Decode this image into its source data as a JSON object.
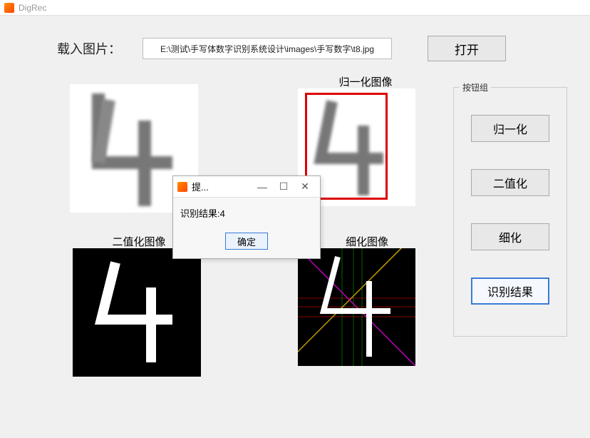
{
  "window": {
    "title": "DigRec"
  },
  "load": {
    "label": "载入图片：",
    "path": "E:\\测试\\手写体数字识别系统设计\\images\\手写数字\\t8.jpg",
    "open_label": "打开"
  },
  "panels": {
    "normalized_title": "归一化图像",
    "binarized_title": "二值化图像",
    "thinned_title": "细化图像"
  },
  "button_group": {
    "legend": "按钮组",
    "normalize": "归一化",
    "binarize": "二值化",
    "thin": "细化",
    "recognize": "识别结果"
  },
  "dialog": {
    "title": "提...",
    "body": "识别结果:4",
    "ok": "确定",
    "minimize": "—",
    "maximize": "☐",
    "close": "✕"
  },
  "recognized_digit": "4"
}
